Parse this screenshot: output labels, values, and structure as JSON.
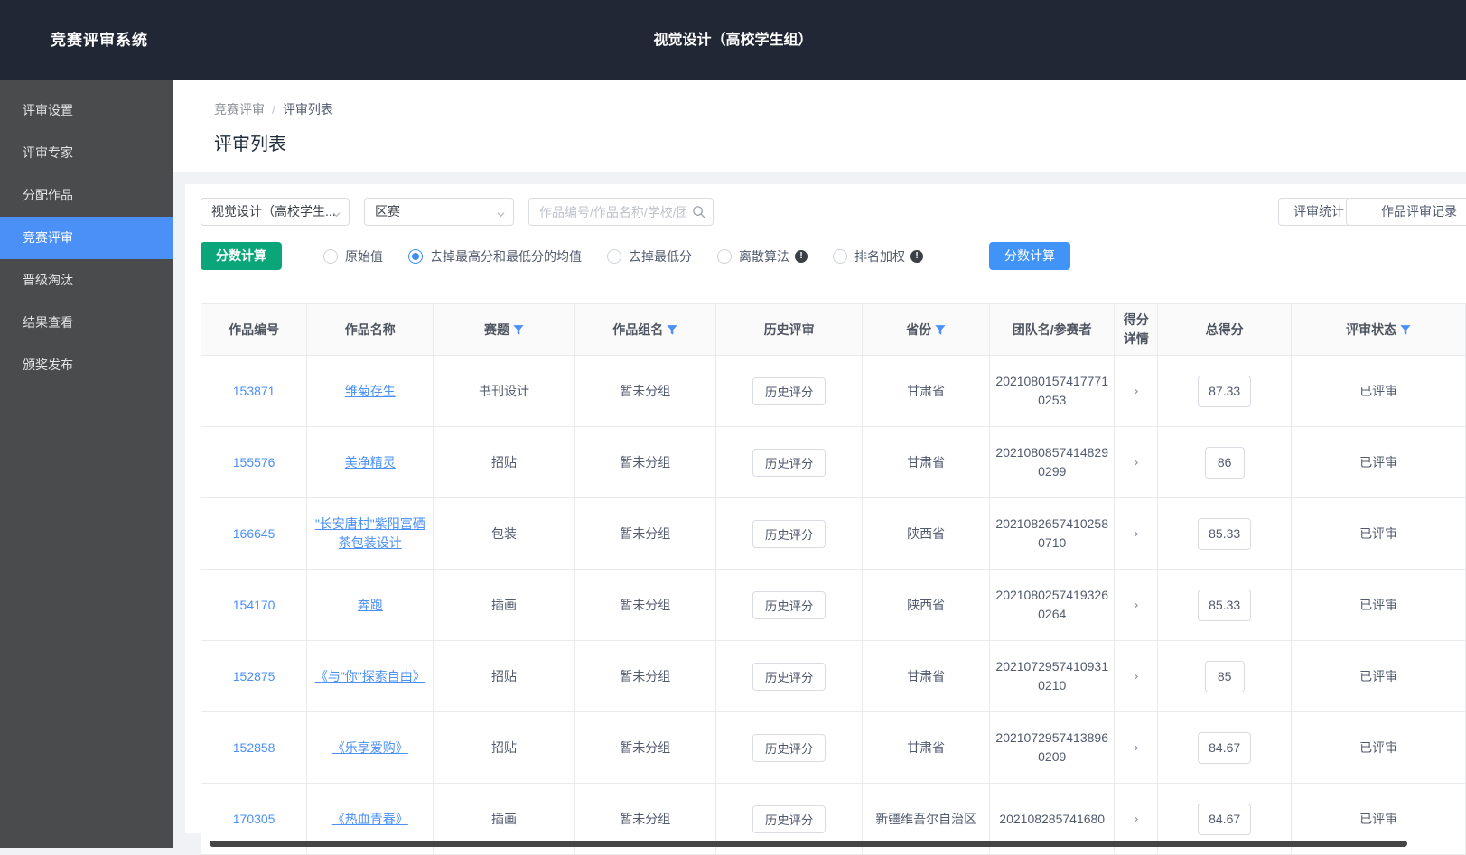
{
  "header": {
    "app_title": "竞赛评审系统",
    "context_title": "视觉设计（高校学生组）"
  },
  "sidebar": {
    "items": [
      {
        "label": "评审设置",
        "active": false
      },
      {
        "label": "评审专家",
        "active": false
      },
      {
        "label": "分配作品",
        "active": false
      },
      {
        "label": "竞赛评审",
        "active": true
      },
      {
        "label": "晋级淘汰",
        "active": false
      },
      {
        "label": "结果查看",
        "active": false
      },
      {
        "label": "颁奖发布",
        "active": false
      }
    ]
  },
  "breadcrumb": {
    "parent": "竞赛评审",
    "separator": "/",
    "current": "评审列表"
  },
  "page": {
    "title": "评审列表"
  },
  "filters": {
    "competition_select": "视觉设计（高校学生...",
    "stage_select": "区赛",
    "search_placeholder": "作品编号/作品名称/学校/团队",
    "stats_button": "评审统计",
    "records_button": "作品评审记录"
  },
  "score_calc": {
    "tag_label": "分数计算",
    "calc_button": "分数计算",
    "options": [
      {
        "label": "原始值",
        "selected": false,
        "info": false
      },
      {
        "label": "去掉最高分和最低分的均值",
        "selected": true,
        "info": false
      },
      {
        "label": "去掉最低分",
        "selected": false,
        "info": false
      },
      {
        "label": "离散算法",
        "selected": false,
        "info": true
      },
      {
        "label": "排名加权",
        "selected": false,
        "info": true
      }
    ]
  },
  "table": {
    "columns": [
      {
        "label": "作品编号",
        "filter": false
      },
      {
        "label": "作品名称",
        "filter": false
      },
      {
        "label": "赛题",
        "filter": true
      },
      {
        "label": "作品组名",
        "filter": true
      },
      {
        "label": "历史评审",
        "filter": false
      },
      {
        "label": "省份",
        "filter": true
      },
      {
        "label": "团队名/参赛者",
        "filter": false
      },
      {
        "label": "得分详情",
        "filter": false
      },
      {
        "label": "总得分",
        "filter": false
      },
      {
        "label": "评审状态",
        "filter": true
      }
    ],
    "history_button_label": "历史评分",
    "rows": [
      {
        "id": "153871",
        "name": "雏菊存生",
        "topic": "书刊设计",
        "group": "暂未分组",
        "province": "甘肃省",
        "team": "20210801574177710253",
        "score": "87.33",
        "status": "已评审"
      },
      {
        "id": "155576",
        "name": "美净精灵",
        "topic": "招贴",
        "group": "暂未分组",
        "province": "甘肃省",
        "team": "20210808574148290299",
        "score": "86",
        "status": "已评审"
      },
      {
        "id": "166645",
        "name": "\"长安唐村\"紫阳富硒茶包装设计",
        "topic": "包装",
        "group": "暂未分组",
        "province": "陕西省",
        "team": "20210826574102580710",
        "score": "85.33",
        "status": "已评审"
      },
      {
        "id": "154170",
        "name": "奔跑",
        "topic": "插画",
        "group": "暂未分组",
        "province": "陕西省",
        "team": "20210802574193260264",
        "score": "85.33",
        "status": "已评审"
      },
      {
        "id": "152875",
        "name": "《与\"你\"探索自由》",
        "topic": "招贴",
        "group": "暂未分组",
        "province": "甘肃省",
        "team": "20210729574109310210",
        "score": "85",
        "status": "已评审"
      },
      {
        "id": "152858",
        "name": "《乐享爱购》",
        "topic": "招贴",
        "group": "暂未分组",
        "province": "甘肃省",
        "team": "20210729574138960209",
        "score": "84.67",
        "status": "已评审"
      },
      {
        "id": "170305",
        "name": "《热血青春》",
        "topic": "插画",
        "group": "暂未分组",
        "province": "新疆维吾尔自治区",
        "team": "202108285741680",
        "score": "84.67",
        "status": "已评审"
      }
    ]
  },
  "colors": {
    "header_bg": "#212734",
    "sidebar_bg": "#4a4b4d",
    "accent_blue": "#4a90f7",
    "button_blue": "#4093f7",
    "tag_green": "#0aa679",
    "table_header_bg": "#fafafa",
    "status_text": "#515a6e"
  }
}
